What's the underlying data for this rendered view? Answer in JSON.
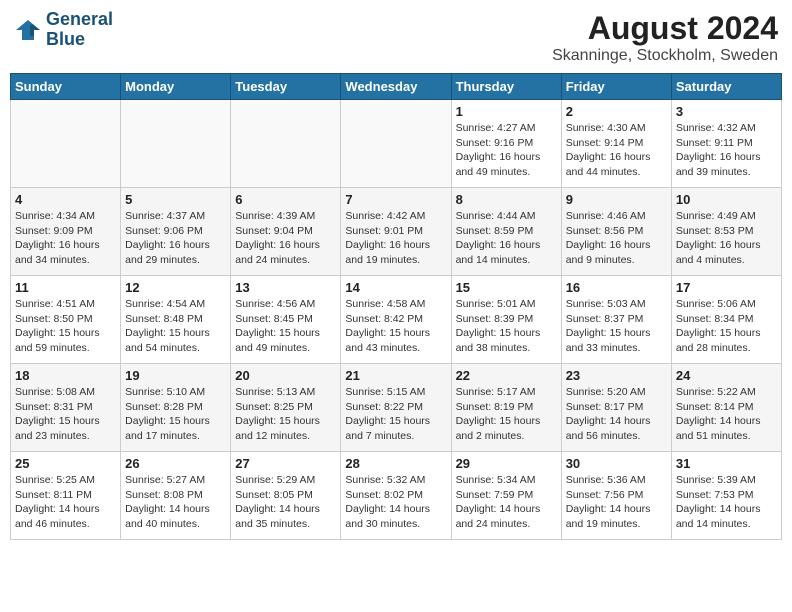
{
  "header": {
    "logo_line1": "General",
    "logo_line2": "Blue",
    "title": "August 2024",
    "subtitle": "Skanninge, Stockholm, Sweden"
  },
  "weekdays": [
    "Sunday",
    "Monday",
    "Tuesday",
    "Wednesday",
    "Thursday",
    "Friday",
    "Saturday"
  ],
  "weeks": [
    [
      {
        "num": "",
        "detail": ""
      },
      {
        "num": "",
        "detail": ""
      },
      {
        "num": "",
        "detail": ""
      },
      {
        "num": "",
        "detail": ""
      },
      {
        "num": "1",
        "detail": "Sunrise: 4:27 AM\nSunset: 9:16 PM\nDaylight: 16 hours\nand 49 minutes."
      },
      {
        "num": "2",
        "detail": "Sunrise: 4:30 AM\nSunset: 9:14 PM\nDaylight: 16 hours\nand 44 minutes."
      },
      {
        "num": "3",
        "detail": "Sunrise: 4:32 AM\nSunset: 9:11 PM\nDaylight: 16 hours\nand 39 minutes."
      }
    ],
    [
      {
        "num": "4",
        "detail": "Sunrise: 4:34 AM\nSunset: 9:09 PM\nDaylight: 16 hours\nand 34 minutes."
      },
      {
        "num": "5",
        "detail": "Sunrise: 4:37 AM\nSunset: 9:06 PM\nDaylight: 16 hours\nand 29 minutes."
      },
      {
        "num": "6",
        "detail": "Sunrise: 4:39 AM\nSunset: 9:04 PM\nDaylight: 16 hours\nand 24 minutes."
      },
      {
        "num": "7",
        "detail": "Sunrise: 4:42 AM\nSunset: 9:01 PM\nDaylight: 16 hours\nand 19 minutes."
      },
      {
        "num": "8",
        "detail": "Sunrise: 4:44 AM\nSunset: 8:59 PM\nDaylight: 16 hours\nand 14 minutes."
      },
      {
        "num": "9",
        "detail": "Sunrise: 4:46 AM\nSunset: 8:56 PM\nDaylight: 16 hours\nand 9 minutes."
      },
      {
        "num": "10",
        "detail": "Sunrise: 4:49 AM\nSunset: 8:53 PM\nDaylight: 16 hours\nand 4 minutes."
      }
    ],
    [
      {
        "num": "11",
        "detail": "Sunrise: 4:51 AM\nSunset: 8:50 PM\nDaylight: 15 hours\nand 59 minutes."
      },
      {
        "num": "12",
        "detail": "Sunrise: 4:54 AM\nSunset: 8:48 PM\nDaylight: 15 hours\nand 54 minutes."
      },
      {
        "num": "13",
        "detail": "Sunrise: 4:56 AM\nSunset: 8:45 PM\nDaylight: 15 hours\nand 49 minutes."
      },
      {
        "num": "14",
        "detail": "Sunrise: 4:58 AM\nSunset: 8:42 PM\nDaylight: 15 hours\nand 43 minutes."
      },
      {
        "num": "15",
        "detail": "Sunrise: 5:01 AM\nSunset: 8:39 PM\nDaylight: 15 hours\nand 38 minutes."
      },
      {
        "num": "16",
        "detail": "Sunrise: 5:03 AM\nSunset: 8:37 PM\nDaylight: 15 hours\nand 33 minutes."
      },
      {
        "num": "17",
        "detail": "Sunrise: 5:06 AM\nSunset: 8:34 PM\nDaylight: 15 hours\nand 28 minutes."
      }
    ],
    [
      {
        "num": "18",
        "detail": "Sunrise: 5:08 AM\nSunset: 8:31 PM\nDaylight: 15 hours\nand 23 minutes."
      },
      {
        "num": "19",
        "detail": "Sunrise: 5:10 AM\nSunset: 8:28 PM\nDaylight: 15 hours\nand 17 minutes."
      },
      {
        "num": "20",
        "detail": "Sunrise: 5:13 AM\nSunset: 8:25 PM\nDaylight: 15 hours\nand 12 minutes."
      },
      {
        "num": "21",
        "detail": "Sunrise: 5:15 AM\nSunset: 8:22 PM\nDaylight: 15 hours\nand 7 minutes."
      },
      {
        "num": "22",
        "detail": "Sunrise: 5:17 AM\nSunset: 8:19 PM\nDaylight: 15 hours\nand 2 minutes."
      },
      {
        "num": "23",
        "detail": "Sunrise: 5:20 AM\nSunset: 8:17 PM\nDaylight: 14 hours\nand 56 minutes."
      },
      {
        "num": "24",
        "detail": "Sunrise: 5:22 AM\nSunset: 8:14 PM\nDaylight: 14 hours\nand 51 minutes."
      }
    ],
    [
      {
        "num": "25",
        "detail": "Sunrise: 5:25 AM\nSunset: 8:11 PM\nDaylight: 14 hours\nand 46 minutes."
      },
      {
        "num": "26",
        "detail": "Sunrise: 5:27 AM\nSunset: 8:08 PM\nDaylight: 14 hours\nand 40 minutes."
      },
      {
        "num": "27",
        "detail": "Sunrise: 5:29 AM\nSunset: 8:05 PM\nDaylight: 14 hours\nand 35 minutes."
      },
      {
        "num": "28",
        "detail": "Sunrise: 5:32 AM\nSunset: 8:02 PM\nDaylight: 14 hours\nand 30 minutes."
      },
      {
        "num": "29",
        "detail": "Sunrise: 5:34 AM\nSunset: 7:59 PM\nDaylight: 14 hours\nand 24 minutes."
      },
      {
        "num": "30",
        "detail": "Sunrise: 5:36 AM\nSunset: 7:56 PM\nDaylight: 14 hours\nand 19 minutes."
      },
      {
        "num": "31",
        "detail": "Sunrise: 5:39 AM\nSunset: 7:53 PM\nDaylight: 14 hours\nand 14 minutes."
      }
    ]
  ]
}
